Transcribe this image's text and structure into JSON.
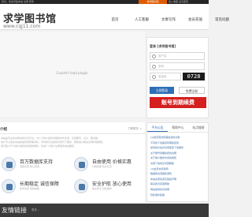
{
  "topbar": {
    "message": "您好，欢迎光临本站 注册 登录",
    "hot_label": "求学图书馆",
    "right_text": "加入收藏 设为首页"
  },
  "site": {
    "title": "求学图书馆",
    "url": "www.cqj11.com"
  },
  "nav": {
    "items": [
      {
        "label": "首页",
        "active": true
      },
      {
        "label": "人工客服",
        "active": false
      },
      {
        "label": "文章写作",
        "active": false
      },
      {
        "label": "会员充值",
        "active": false
      },
      {
        "label": "常见问题",
        "active": false
      }
    ]
  },
  "plugin": {
    "message": "Couldn't load plugin."
  },
  "login": {
    "title": "登录 [求学图书馆]",
    "username_placeholder": "用户名",
    "password_placeholder": "密码",
    "captcha_placeholder": "验证码",
    "captcha_value": "0728",
    "login_button": "立即登录",
    "register_button": "免费注册",
    "banner": "账号到期续费"
  },
  "intro": {
    "heading": "介绍",
    "more": "了解更多 >",
    "paragraphs": [
      "本站是专业的文献资料分享平台，为广大用户提供海量的学术资源，包括期刊、论文、图书等。",
      "用户可以通过本站快速获取所需资料，同时我们也提供代查代下服务，帮助用户解决文献获取难题。",
      "我们致力于为用户提供最优质的服务，欢迎广大用户注册使用本站服务。"
    ],
    "features": [
      {
        "title": "百万数据库支持",
        "desc": "海量资源 随心查阅"
      },
      {
        "title": "自由使用 价格实惠",
        "desc": "价格低廉 性价比高"
      },
      {
        "title": "长期稳定 诚信保障",
        "desc": "多年运营 值得信赖"
      },
      {
        "title": "安全护航 放心使用",
        "desc": "信息安全 隐私保护"
      }
    ]
  },
  "side": {
    "tabs": [
      {
        "label": "平台公告",
        "active": true
      },
      {
        "label": "帮助中心",
        "active": false
      },
      {
        "label": "站点链接",
        "active": false
      }
    ],
    "items": [
      "[1]如何查找所需的资料文献",
      "不同的下载渠道有哪些区别",
      "如何成为会员享受更多下载服务",
      "关于账号到期续费的说明",
      "关于客户服务时间的通知",
      "文献下载常见问题解答",
      "vip会员充值说明",
      "数据库资源更新通知",
      "本站资源来源及版权声明",
      "联系我们获取帮助",
      "网站使用条款说明",
      "隐私保护政策"
    ]
  },
  "footer": {
    "title": "友情链接",
    "sub": "更多..."
  }
}
